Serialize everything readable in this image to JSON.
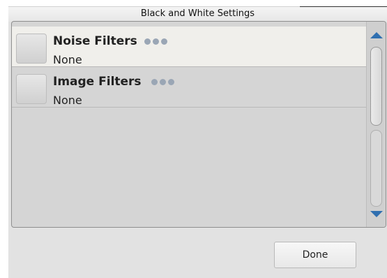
{
  "window": {
    "title": "Black and White Settings"
  },
  "list": {
    "items": [
      {
        "label": "Noise Filters",
        "value": "None",
        "more_icon": "more-dots-icon",
        "selected": true
      },
      {
        "label": "Image Filters",
        "value": "None",
        "more_icon": "more-dots-icon",
        "selected": false
      }
    ]
  },
  "scrollbar": {
    "up_icon": "scroll-up-triangle-icon",
    "down_icon": "scroll-down-triangle-icon"
  },
  "footer": {
    "done_label": "Done"
  },
  "colors": {
    "accent_arrow": "#2f6fb0",
    "selected_row": "#f0efeb",
    "panel": "#d5d5d5",
    "dots": "#9aa6b5"
  }
}
